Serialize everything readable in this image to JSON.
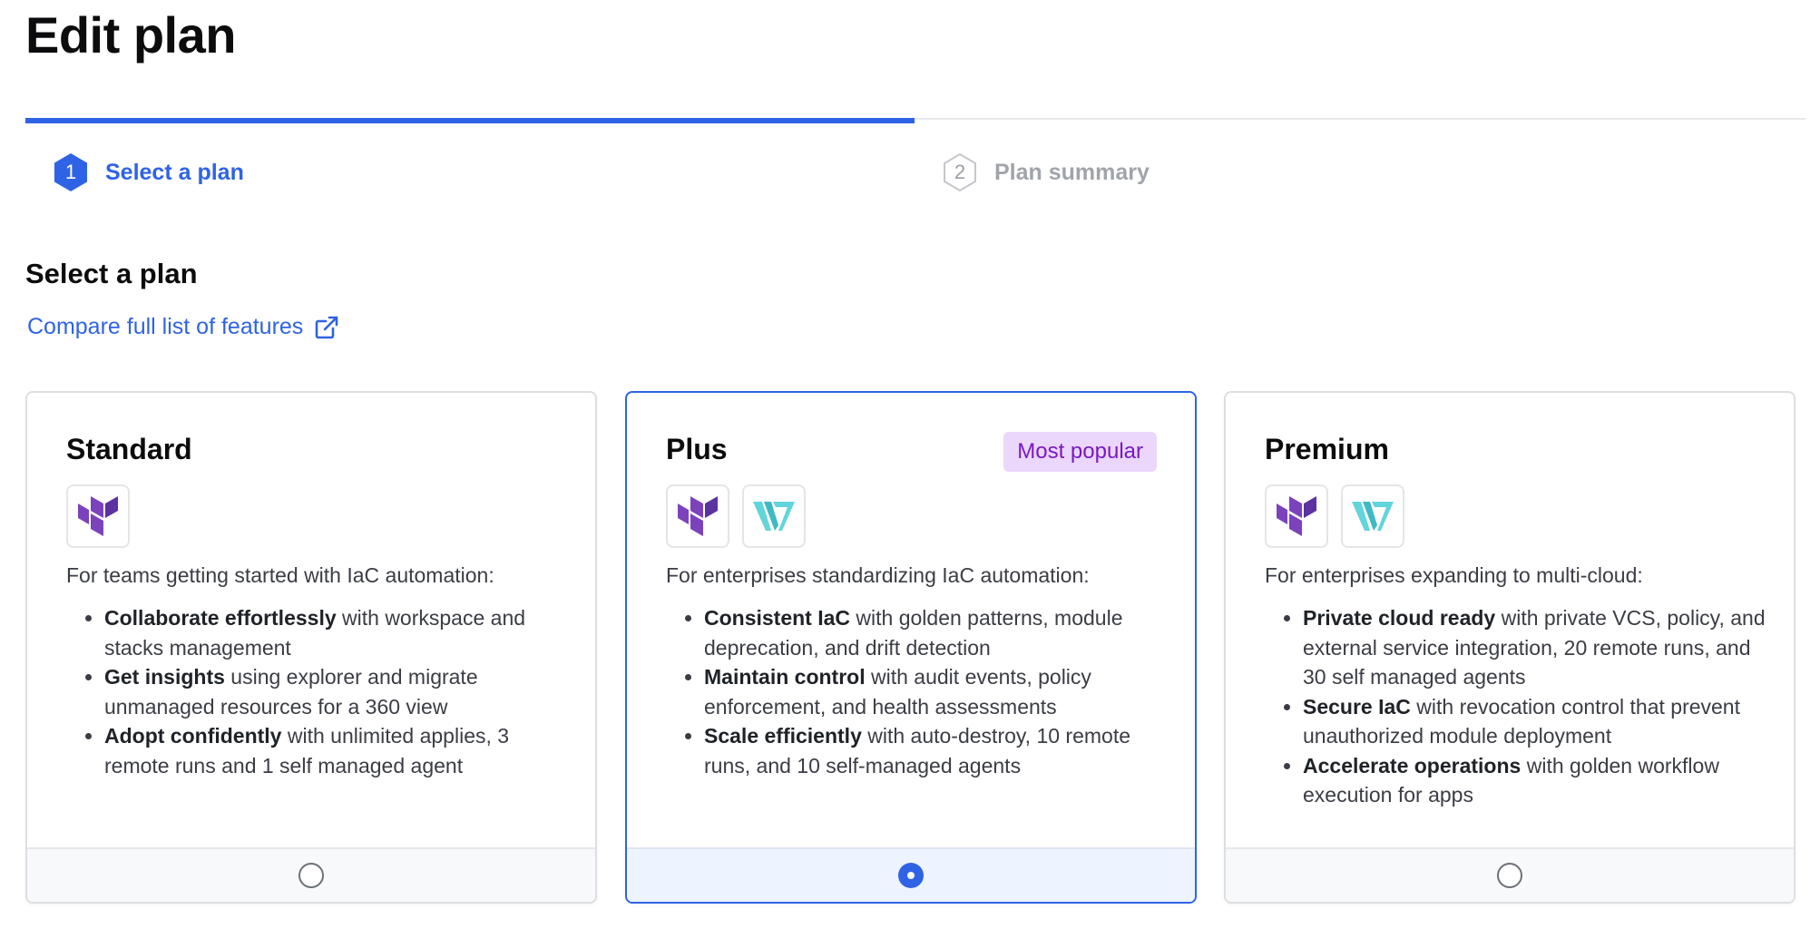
{
  "page": {
    "title": "Edit plan"
  },
  "stepper": {
    "steps": [
      {
        "number": "1",
        "label": "Select a plan",
        "state": "active"
      },
      {
        "number": "2",
        "label": "Plan summary",
        "state": "inactive"
      }
    ],
    "progress": 0.5
  },
  "section": {
    "title": "Select a plan",
    "compare_link": "Compare full list of features",
    "compare_icon": "external-link-icon"
  },
  "colors": {
    "accent": "#2f63e6",
    "badge_bg": "#ead7fb",
    "badge_text": "#7a18c4",
    "terraform_purple": "#7b42bc",
    "waypoint_teal": "#62d4dc"
  },
  "plans": [
    {
      "name": "Standard",
      "badge": "",
      "logos": [
        "terraform-logo-icon"
      ],
      "intro": "For teams getting started with IaC automation:",
      "features": [
        {
          "bold": "Collaborate effortlessly",
          "text": " with workspace and stacks management"
        },
        {
          "bold": "Get insights",
          "text": " using explorer and migrate unmanaged resources for a 360 view"
        },
        {
          "bold": "Adopt confidently",
          "text": " with unlimited applies, 3 remote runs and 1 self managed agent"
        }
      ],
      "selected": false
    },
    {
      "name": "Plus",
      "badge": "Most popular",
      "logos": [
        "terraform-logo-icon",
        "waypoint-logo-icon"
      ],
      "intro": "For enterprises standardizing IaC automation:",
      "features": [
        {
          "bold": "Consistent IaC",
          "text": " with golden patterns, module deprecation, and drift detection"
        },
        {
          "bold": "Maintain control",
          "text": " with audit events, policy enforcement, and health assessments"
        },
        {
          "bold": "Scale efficiently",
          "text": " with auto-destroy, 10 remote runs, and 10 self-managed agents"
        }
      ],
      "selected": true
    },
    {
      "name": "Premium",
      "badge": "",
      "logos": [
        "terraform-logo-icon",
        "waypoint-logo-icon"
      ],
      "intro": "For enterprises expanding to multi-cloud:",
      "features": [
        {
          "bold": "Private cloud ready",
          "text": " with private VCS, policy, and external service integration, 20 remote runs, and 30 self managed agents"
        },
        {
          "bold": "Secure IaC",
          "text": " with revocation control that prevent unauthorized module deployment"
        },
        {
          "bold": "Accelerate operations",
          "text": " with golden workflow execution for apps"
        }
      ],
      "selected": false
    }
  ]
}
